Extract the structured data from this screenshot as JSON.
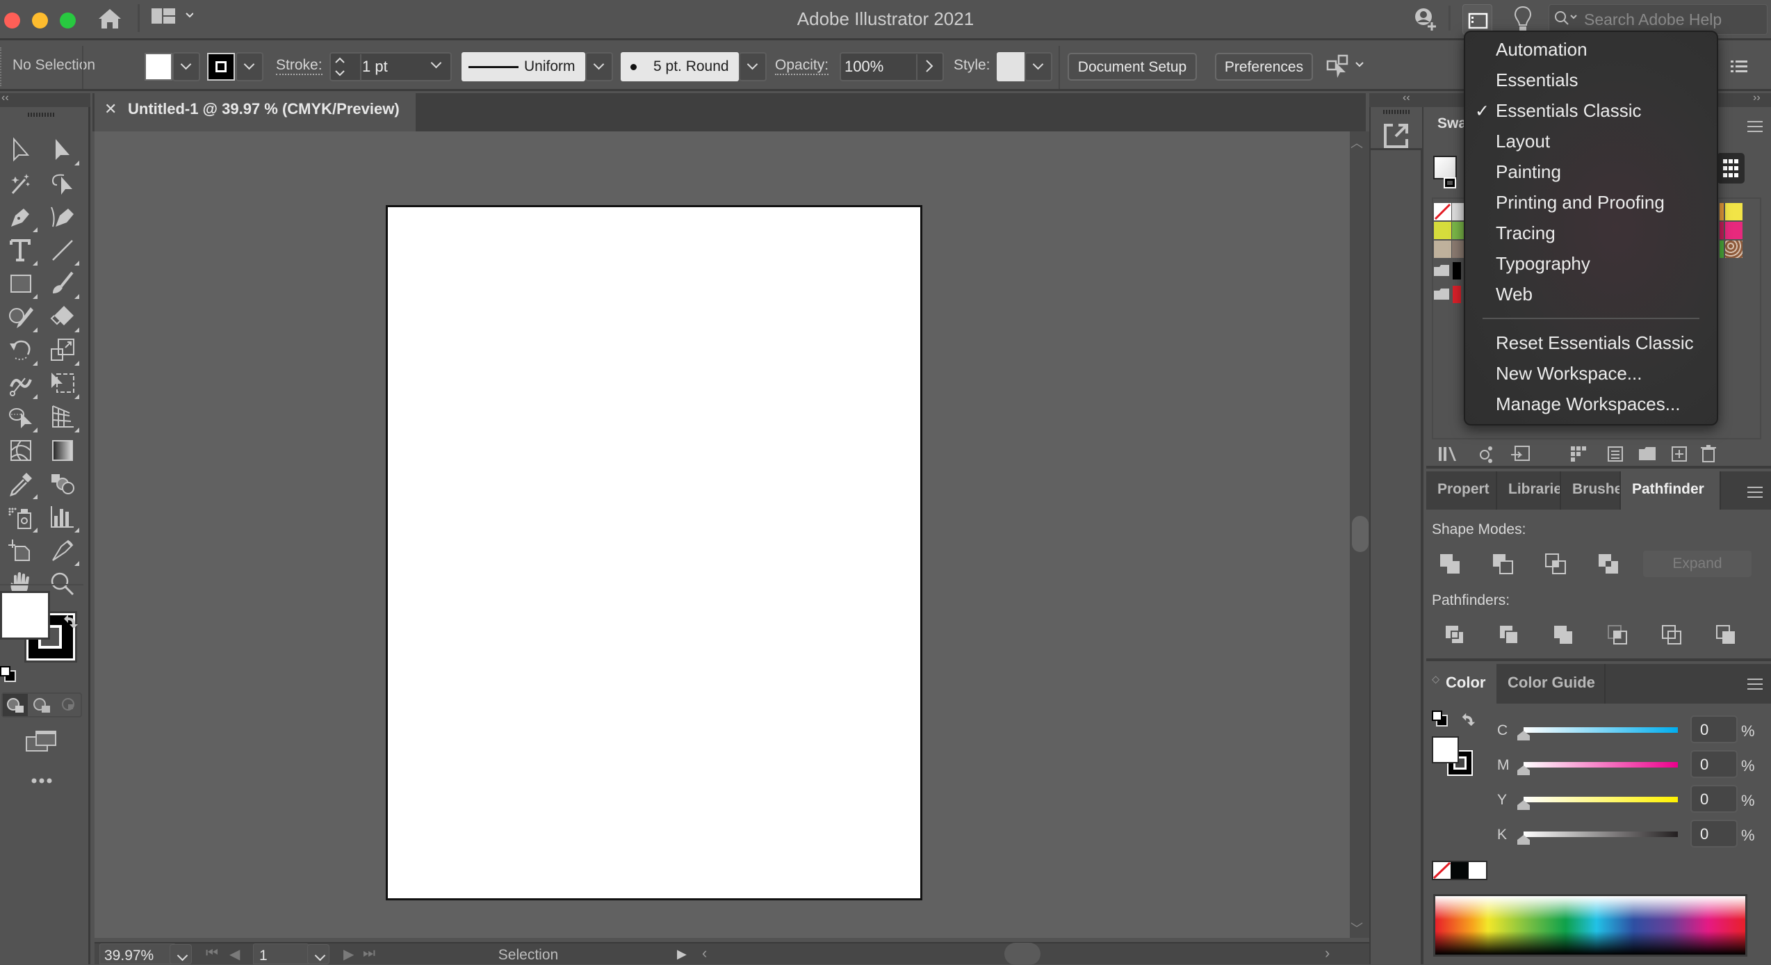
{
  "app": {
    "title": "Adobe Illustrator 2021",
    "search_placeholder": "Search Adobe Help"
  },
  "window_controls": {
    "close_color": "#ff5f57",
    "minimize_color": "#febc2e",
    "maximize_color": "#28c840"
  },
  "control_bar": {
    "selection_status": "No Selection",
    "fill_color": "#ffffff",
    "stroke_label": "Stroke:",
    "stroke_weight": "1 pt",
    "variable_width_profile": "Uniform",
    "brush_definition": "5 pt. Round",
    "opacity_label": "Opacity:",
    "opacity_value": "100%",
    "style_label": "Style:",
    "document_setup_label": "Document Setup",
    "preferences_label": "Preferences"
  },
  "document": {
    "tab_title": "Untitled-1 @ 39.97 % (CMYK/Preview)",
    "zoom_level": "39.97%",
    "artboard_number": "1",
    "status_text": "Selection"
  },
  "tools": [
    "selection-tool",
    "direct-selection-tool",
    "magic-wand-tool",
    "lasso-tool",
    "pen-tool",
    "curvature-tool",
    "type-tool",
    "line-segment-tool",
    "rectangle-tool",
    "paintbrush-tool",
    "shaper-tool",
    "eraser-tool",
    "rotate-tool",
    "scale-tool",
    "warp-tool",
    "free-transform-tool",
    "shape-builder-tool",
    "perspective-grid-tool",
    "mesh-tool",
    "gradient-tool",
    "eyedropper-tool",
    "blend-tool",
    "symbol-sprayer-tool",
    "column-graph-tool",
    "artboard-tool",
    "slice-tool",
    "hand-tool",
    "zoom-tool"
  ],
  "workspace_menu": {
    "items": [
      {
        "label": "Automation",
        "checked": false
      },
      {
        "label": "Essentials",
        "checked": false
      },
      {
        "label": "Essentials Classic",
        "checked": true
      },
      {
        "label": "Layout",
        "checked": false
      },
      {
        "label": "Painting",
        "checked": false
      },
      {
        "label": "Printing and Proofing",
        "checked": false
      },
      {
        "label": "Tracing",
        "checked": false
      },
      {
        "label": "Typography",
        "checked": false
      },
      {
        "label": "Web",
        "checked": false
      }
    ],
    "actions": [
      {
        "label": "Reset Essentials Classic"
      },
      {
        "label": "New Workspace..."
      },
      {
        "label": "Manage Workspaces..."
      }
    ],
    "check_glyph": "✓"
  },
  "swatches_panel": {
    "title_visible": "Swa",
    "swatch_colors_left": [
      "none",
      "#d6dc3c",
      "#bfb19c",
      "#000000",
      "#d8202a"
    ],
    "swatch_colors_right": [
      "#f2e447",
      "#e7297d",
      "pattern"
    ]
  },
  "pathfinder_panel": {
    "tabs": [
      {
        "label": "Propert",
        "active": false
      },
      {
        "label": "Librarie",
        "active": false
      },
      {
        "label": "Brushes",
        "active": false
      },
      {
        "label": "Pathfinder",
        "active": true
      }
    ],
    "shape_modes_label": "Shape Modes:",
    "shape_modes": [
      "unite",
      "minus-front",
      "intersect",
      "exclude"
    ],
    "expand_label": "Expand",
    "pathfinders_label": "Pathfinders:",
    "pathfinders": [
      "divide",
      "trim",
      "merge",
      "crop",
      "outline",
      "minus-back"
    ]
  },
  "color_panel": {
    "tabs": [
      {
        "label": "Color",
        "active": true
      },
      {
        "label": "Color Guide",
        "active": false
      }
    ],
    "channels": [
      {
        "label": "C",
        "value": "0",
        "unit": "%",
        "color": "#00aeef"
      },
      {
        "label": "M",
        "value": "0",
        "unit": "%",
        "color": "#ec008c"
      },
      {
        "label": "Y",
        "value": "0",
        "unit": "%",
        "color": "#fff200"
      },
      {
        "label": "K",
        "value": "0",
        "unit": "%",
        "color": "#231f20"
      }
    ]
  }
}
